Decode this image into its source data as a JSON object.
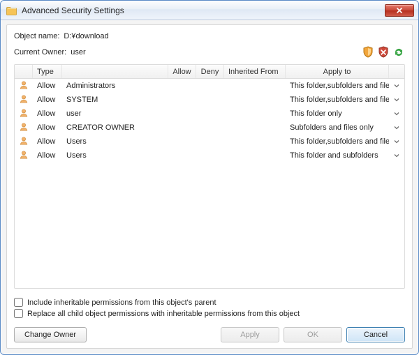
{
  "window": {
    "title": "Advanced Security Settings"
  },
  "meta": {
    "object_label": "Object name:",
    "object_value": "D:¥download",
    "owner_label": "Current Owner:",
    "owner_value": "user"
  },
  "toolbar": {
    "icons": [
      "shield-orange-icon",
      "shield-red-icon",
      "refresh-icon"
    ]
  },
  "table": {
    "headers": {
      "icon": "",
      "type": "Type",
      "name": "",
      "allow": "Allow",
      "deny": "Deny",
      "inherited": "Inherited From",
      "apply": "Apply to",
      "menu": ""
    },
    "rows": [
      {
        "type": "Allow",
        "name": "Administrators",
        "allow": "",
        "deny": "",
        "inherited": "",
        "apply": "This folder,subfolders and files"
      },
      {
        "type": "Allow",
        "name": "SYSTEM",
        "allow": "",
        "deny": "",
        "inherited": "",
        "apply": "This folder,subfolders and files"
      },
      {
        "type": "Allow",
        "name": "user",
        "allow": "",
        "deny": "",
        "inherited": "",
        "apply": "This folder only"
      },
      {
        "type": "Allow",
        "name": "CREATOR OWNER",
        "allow": "",
        "deny": "",
        "inherited": "",
        "apply": "Subfolders and files only"
      },
      {
        "type": "Allow",
        "name": "Users",
        "allow": "",
        "deny": "",
        "inherited": "",
        "apply": "This folder,subfolders and files"
      },
      {
        "type": "Allow",
        "name": "Users",
        "allow": "",
        "deny": "",
        "inherited": "",
        "apply": "This folder and subfolders"
      }
    ]
  },
  "checks": {
    "inherit_label": "Include inheritable permissions from this object's parent",
    "inherit_checked": false,
    "replace_label": "Replace all child object permissions with inheritable permissions from this object",
    "replace_checked": false
  },
  "buttons": {
    "change_owner": "Change Owner",
    "apply": "Apply",
    "ok": "OK",
    "cancel": "Cancel"
  }
}
